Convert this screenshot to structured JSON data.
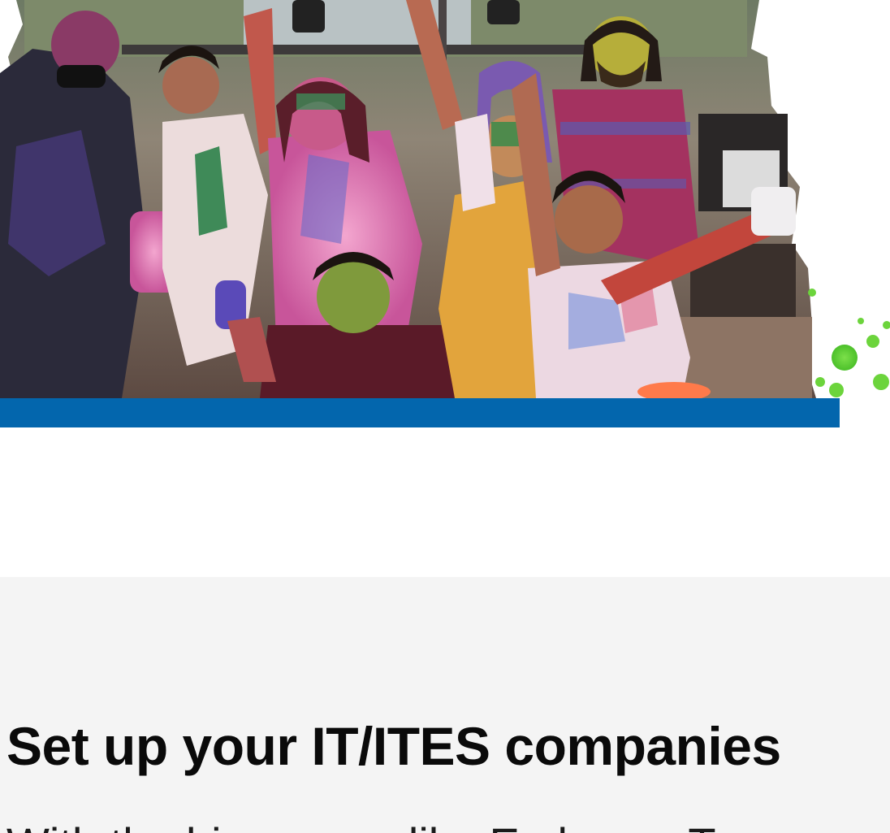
{
  "hero": {
    "photo_icon": "holi-celebration-photo",
    "bar_color": "#0366ad"
  },
  "section": {
    "title": "Set up your IT/ITES companies",
    "body": "With the big names like Embassy Te"
  }
}
